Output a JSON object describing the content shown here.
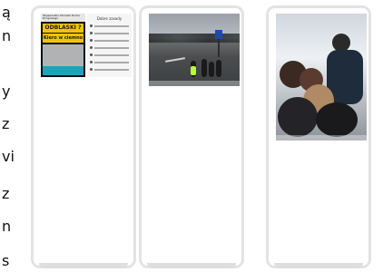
{
  "left_text": {
    "letters": [
      "ą",
      "n",
      "y",
      "z",
      "vi",
      "z",
      "n",
      "s"
    ]
  },
  "cards": [
    {
      "id": "poster",
      "poster": {
        "left_header": "Wojewódzki Ośrodek Ruchu Drogowego",
        "headline_1": "ODBLASKI ?",
        "headline_2": "Kiero w ciemno !",
        "right_title": "Dobre zasady"
      }
    },
    {
      "id": "road-photo"
    },
    {
      "id": "class-photo"
    }
  ],
  "colors": {
    "card_border": "#e3e3e3",
    "poster_yellow": "#f2c400",
    "poster_teal": "#1fa3b8",
    "hi_vis": "#b6ff3a"
  }
}
